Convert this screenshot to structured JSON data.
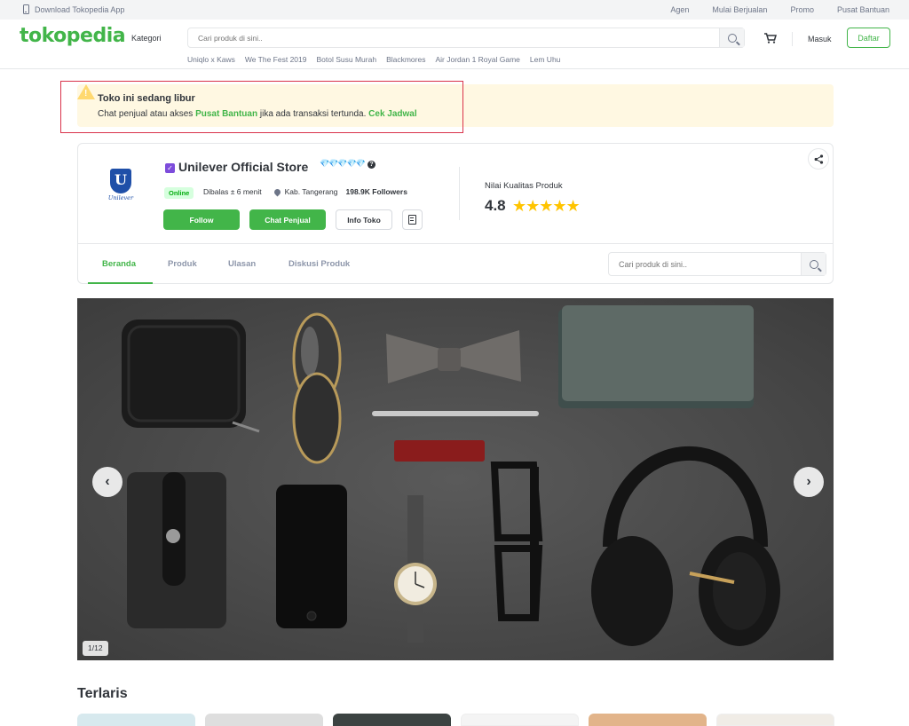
{
  "topbar": {
    "download_app": "Download Tokopedia App",
    "links": [
      "Agen",
      "Mulai Berjualan",
      "Promo",
      "Pusat Bantuan"
    ]
  },
  "header": {
    "logo": "tokopedia",
    "kategori": "Kategori",
    "search_placeholder": "Cari produk di sini..",
    "quick_links": [
      "Uniqlo x Kaws",
      "We The Fest 2019",
      "Botol Susu Murah",
      "Blackmores",
      "Air Jordan 1 Royal Game",
      "Lem Uhu"
    ],
    "masuk": "Masuk",
    "daftar": "Daftar",
    "brand_color": "#42b549"
  },
  "notice": {
    "title": "Toko ini sedang libur",
    "message_prefix": "Chat penjual atau akses ",
    "link_help": "Pusat Bantuan",
    "message_middle": " jika ada transaksi tertunda. ",
    "link_schedule": "Cek Jadwal"
  },
  "shop": {
    "logo_letter": "U",
    "logo_word": "Unilever",
    "name": "Unilever Official Store",
    "status": "Online",
    "reply_time": "Dibalas ± 6 menit",
    "location": "Kab. Tangerang",
    "followers": "198.9K Followers",
    "buttons": {
      "follow": "Follow",
      "chat": "Chat Penjual",
      "info": "Info Toko"
    },
    "quality_label": "Nilai Kualitas Produk",
    "quality_score": "4.8",
    "quality_stars": 5
  },
  "tabs": [
    {
      "label": "Beranda",
      "active": true
    },
    {
      "label": "Produk",
      "active": false
    },
    {
      "label": "Ulasan",
      "active": false
    },
    {
      "label": "Diskusi Produk",
      "active": false
    }
  ],
  "shop_search_placeholder": "Cari produk di sini..",
  "banner": {
    "counter": "1/12"
  },
  "section": {
    "terlaris": "Terlaris"
  }
}
